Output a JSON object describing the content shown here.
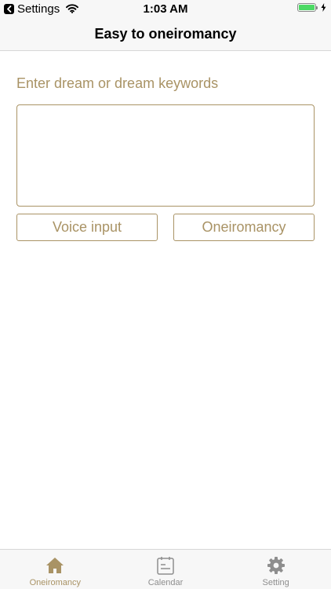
{
  "status_bar": {
    "back_app": "Settings",
    "time": "1:03 AM",
    "battery_level": 1.0
  },
  "nav": {
    "title": "Easy to oneiromancy"
  },
  "main": {
    "prompt": "Enter dream or dream keywords",
    "dream_input": {
      "value": "",
      "placeholder": ""
    },
    "voice_button": "Voice input",
    "oneiromancy_button": "Oneiromancy"
  },
  "tabs": [
    {
      "label": "Oneiromancy",
      "icon": "house-icon",
      "active": true
    },
    {
      "label": "Calendar",
      "icon": "calendar-icon",
      "active": false
    },
    {
      "label": "Setting",
      "icon": "gear-icon",
      "active": false
    }
  ],
  "colors": {
    "accent": "#a99365",
    "inactive": "#8e8e8e",
    "bar_background": "#f7f7f7"
  }
}
